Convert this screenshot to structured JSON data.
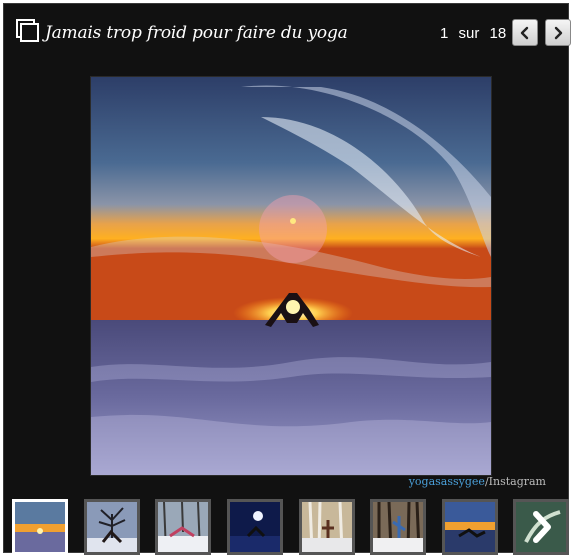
{
  "header": {
    "title": "Jamais trop froid pour faire du yoga",
    "counter": {
      "current": "1",
      "separator": "sur",
      "total": "18"
    },
    "icons": {
      "gallery": "gallery-icon",
      "prev": "chevron-left-icon",
      "next": "chevron-right-icon"
    }
  },
  "photo": {
    "description_icon": "photo-sunset-yoga-snow"
  },
  "credit": {
    "user": "yogasassygee",
    "source": "/Instagram"
  },
  "thumbnails": [
    {
      "name": "thumb-sunset-yoga",
      "active": true
    },
    {
      "name": "thumb-tree-yoga",
      "active": false
    },
    {
      "name": "thumb-snow-pose",
      "active": false
    },
    {
      "name": "thumb-night-moon",
      "active": false
    },
    {
      "name": "thumb-birch-forest",
      "active": false
    },
    {
      "name": "thumb-winter-woods",
      "active": false
    },
    {
      "name": "thumb-lake-sunset",
      "active": false
    },
    {
      "name": "thumb-next-arrow",
      "active": false
    }
  ],
  "colors": {
    "background": "#111111",
    "link": "#4a9fd8",
    "text": "#ffffff"
  }
}
